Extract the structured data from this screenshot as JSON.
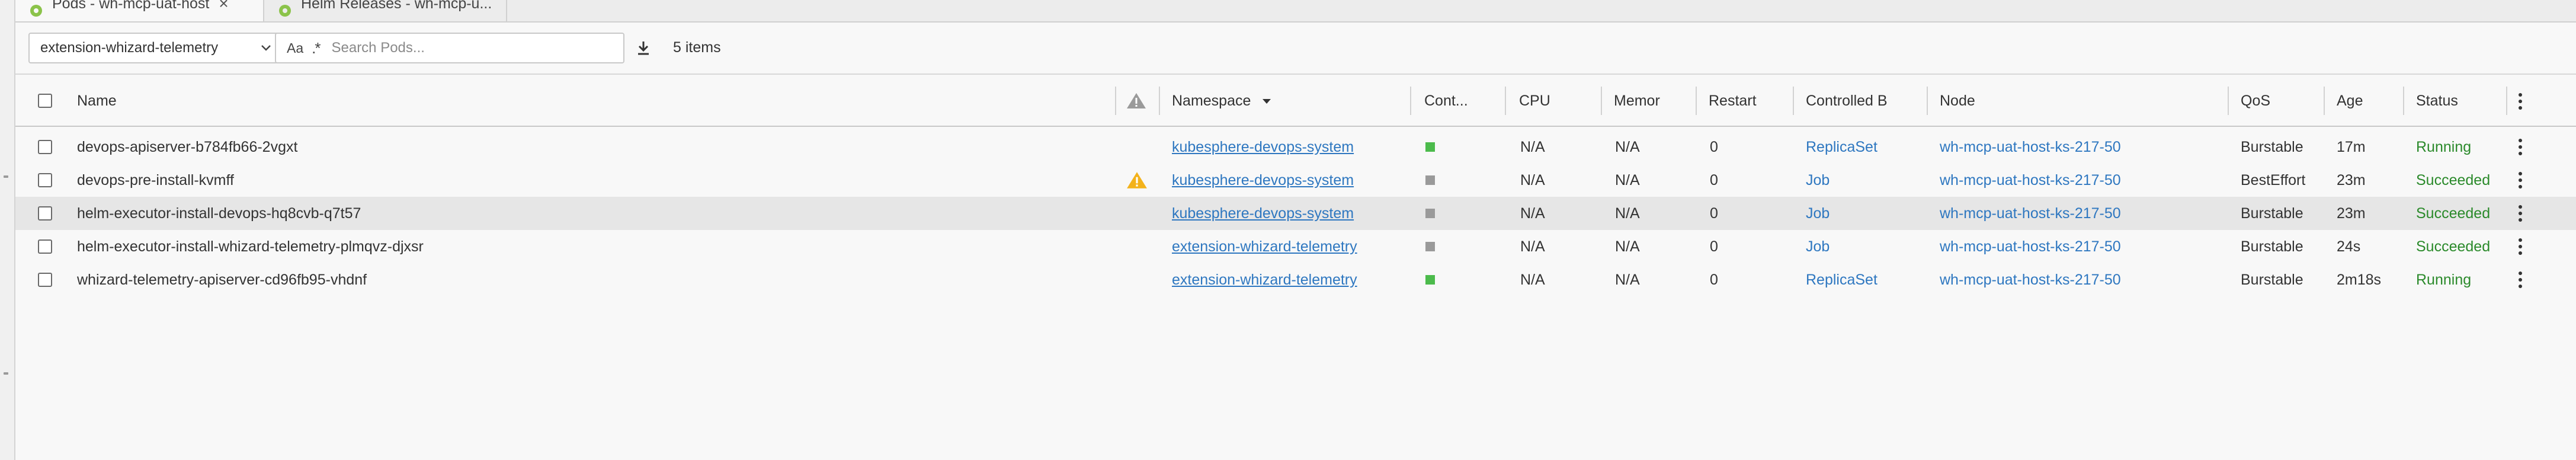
{
  "tabs": [
    {
      "label": "Pods - wh-mcp-uat-host",
      "active": true,
      "closable": true
    },
    {
      "label": "Helm Releases - wh-mcp-u...",
      "active": false,
      "closable": false
    }
  ],
  "toolbar": {
    "namespace": "extension-whizard-telemetry",
    "search_case_label": "Aa",
    "search_regex_label": ".*",
    "search_placeholder": "Search Pods...",
    "items_count": "5 items"
  },
  "table": {
    "columns": [
      {
        "key": "name",
        "label": "Name"
      },
      {
        "key": "warn",
        "label": ""
      },
      {
        "key": "namespace",
        "label": "Namespace"
      },
      {
        "key": "containers",
        "label": "Cont..."
      },
      {
        "key": "cpu",
        "label": "CPU"
      },
      {
        "key": "memory",
        "label": "Memor"
      },
      {
        "key": "restarts",
        "label": "Restart"
      },
      {
        "key": "controlled_by",
        "label": "Controlled B"
      },
      {
        "key": "node",
        "label": "Node"
      },
      {
        "key": "qos",
        "label": "QoS"
      },
      {
        "key": "age",
        "label": "Age"
      },
      {
        "key": "status",
        "label": "Status"
      }
    ],
    "rows": [
      {
        "name": "devops-apiserver-b784fb66-2vgxt",
        "warning": false,
        "namespace": "kubesphere-devops-system",
        "container_color": "#4cbb4c",
        "cpu": "N/A",
        "memory": "N/A",
        "restarts": "0",
        "controlled_by": "ReplicaSet",
        "node": "wh-mcp-uat-host-ks-217-50",
        "qos": "Burstable",
        "age": "17m",
        "status": "Running"
      },
      {
        "name": "devops-pre-install-kvmff",
        "warning": true,
        "namespace": "kubesphere-devops-system",
        "container_color": "#9a9a9a",
        "cpu": "N/A",
        "memory": "N/A",
        "restarts": "0",
        "controlled_by": "Job",
        "node": "wh-mcp-uat-host-ks-217-50",
        "qos": "BestEffort",
        "age": "23m",
        "status": "Succeeded"
      },
      {
        "name": "helm-executor-install-devops-hq8cvb-q7t57",
        "warning": false,
        "namespace": "kubesphere-devops-system",
        "container_color": "#9a9a9a",
        "cpu": "N/A",
        "memory": "N/A",
        "restarts": "0",
        "controlled_by": "Job",
        "node": "wh-mcp-uat-host-ks-217-50",
        "qos": "Burstable",
        "age": "23m",
        "status": "Succeeded"
      },
      {
        "name": "helm-executor-install-whizard-telemetry-plmqvz-djxsr",
        "warning": false,
        "namespace": "extension-whizard-telemetry",
        "container_color": "#9a9a9a",
        "cpu": "N/A",
        "memory": "N/A",
        "restarts": "0",
        "controlled_by": "Job",
        "node": "wh-mcp-uat-host-ks-217-50",
        "qos": "Burstable",
        "age": "24s",
        "status": "Succeeded"
      },
      {
        "name": "whizard-telemetry-apiserver-cd96fb95-vhdnf",
        "warning": false,
        "namespace": "extension-whizard-telemetry",
        "container_color": "#4cbb4c",
        "cpu": "N/A",
        "memory": "N/A",
        "restarts": "0",
        "controlled_by": "ReplicaSet",
        "node": "wh-mcp-uat-host-ks-217-50",
        "qos": "Burstable",
        "age": "2m18s",
        "status": "Running"
      }
    ]
  },
  "colors": {
    "link": "#2e77c0",
    "status_ok": "#2b8a2b",
    "warning": "#f3b21b",
    "container_running": "#4cbb4c",
    "container_terminated": "#9a9a9a"
  },
  "icons": {
    "tab": "gear-icon",
    "namespace_dropdown": "chevron-down-icon",
    "download": "download-icon",
    "warning": "warning-icon",
    "row_menu": "kebab-menu-icon",
    "sort": "sort-desc-icon"
  }
}
